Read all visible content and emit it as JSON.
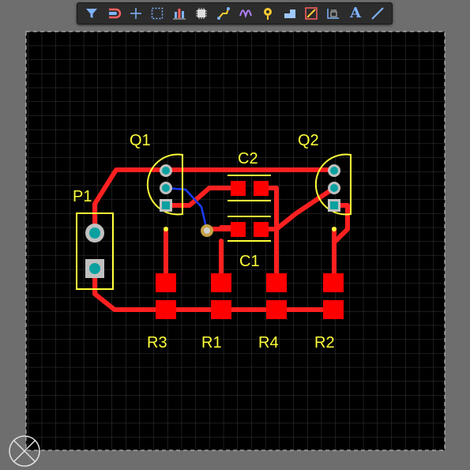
{
  "toolbar": {
    "tools": [
      {
        "name": "filter-icon",
        "label": "Filter"
      },
      {
        "name": "snap-magnet-icon",
        "label": "Snap"
      },
      {
        "name": "crosshair-icon",
        "label": "Cross"
      },
      {
        "name": "select-rect-icon",
        "label": "Select"
      },
      {
        "name": "align-icon",
        "label": "Align"
      },
      {
        "name": "component-icon",
        "label": "Place Component"
      },
      {
        "name": "route-icon",
        "label": "Route"
      },
      {
        "name": "diff-pair-icon",
        "label": "Differential Pair"
      },
      {
        "name": "via-icon",
        "label": "Via"
      },
      {
        "name": "polygon-icon",
        "label": "Polygon"
      },
      {
        "name": "keepout-icon",
        "label": "Keepout"
      },
      {
        "name": "dimension-icon",
        "label": "Dimension"
      },
      {
        "name": "text-icon",
        "label": "A"
      },
      {
        "name": "line-icon",
        "label": "Line"
      }
    ]
  },
  "designators": {
    "q1": "Q1",
    "q2": "Q2",
    "c1": "C1",
    "c2": "C2",
    "p1": "P1",
    "r1": "R1",
    "r2": "R2",
    "r3": "R3",
    "r4": "R4"
  },
  "colors": {
    "background": "#000000",
    "grid": "#3a3a3a",
    "trace_top": "#ff2020",
    "trace_bottom": "#1a3cff",
    "silkscreen": "#ffff3a",
    "pad_ring": "#c0c0c0",
    "pad_hole": "#0aa0a0",
    "canvas_border": "#cfcfcf",
    "ui_bg": "#6e6e6e"
  }
}
